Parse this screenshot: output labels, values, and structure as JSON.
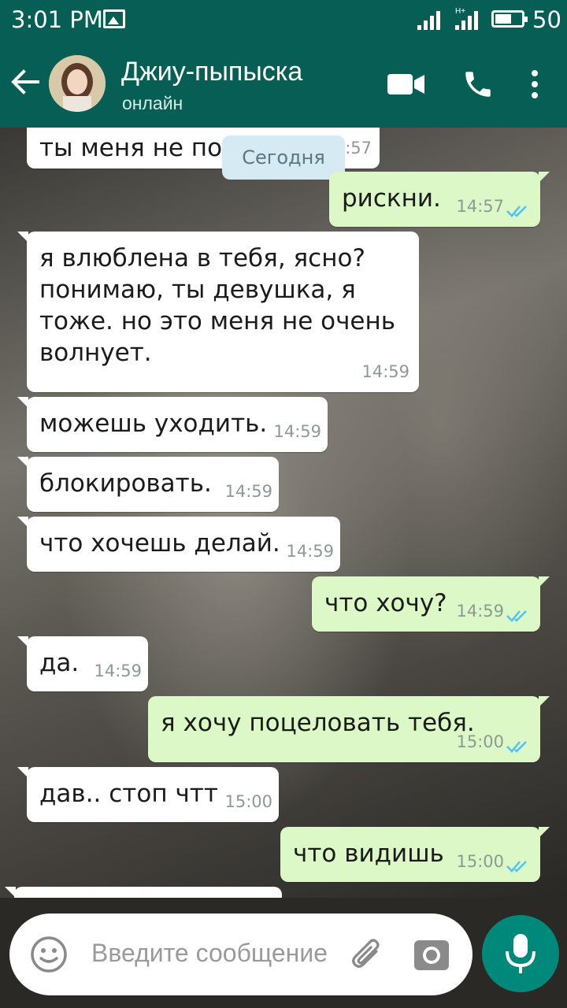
{
  "status_bar": {
    "time": "3:01 PM",
    "network_label": "H+",
    "battery_level": "50"
  },
  "header": {
    "back_icon": "arrow-left-icon",
    "contact_name": "Джиу-пыпыска",
    "contact_status": "онлайн"
  },
  "date_chip": "Сегодня",
  "messages": [
    {
      "dir": "in",
      "text": "ты меня не поймешь",
      "time": "14:57"
    },
    {
      "dir": "out",
      "text": "рискни.",
      "time": "14:57"
    },
    {
      "dir": "in",
      "text": "я влюблена в тебя, ясно? понимаю, ты девушка, я тоже. но это меня не очень волнует.",
      "time": "14:59"
    },
    {
      "dir": "in",
      "text": "можешь уходить.",
      "time": "14:59"
    },
    {
      "dir": "in",
      "text": "блокировать.",
      "time": "14:59"
    },
    {
      "dir": "in",
      "text": "что хочешь делай.",
      "time": "14:59"
    },
    {
      "dir": "out",
      "text": "что хочу?",
      "time": "14:59"
    },
    {
      "dir": "in",
      "text": "да.",
      "time": "14:59"
    },
    {
      "dir": "out",
      "text": "я хочу поцеловать тебя.",
      "time": "15:00"
    },
    {
      "dir": "in",
      "text": "дав.. стоп чтт",
      "time": "15:00"
    },
    {
      "dir": "out",
      "text": "что видишь",
      "time": "15:00"
    }
  ],
  "composer": {
    "placeholder": "Введите сообщение"
  },
  "colors": {
    "header": "#075e54",
    "outgoing_bubble": "#dcf8c6",
    "incoming_bubble": "#ffffff",
    "read_ticks": "#4fc3f7",
    "mic_button": "#00897b"
  }
}
